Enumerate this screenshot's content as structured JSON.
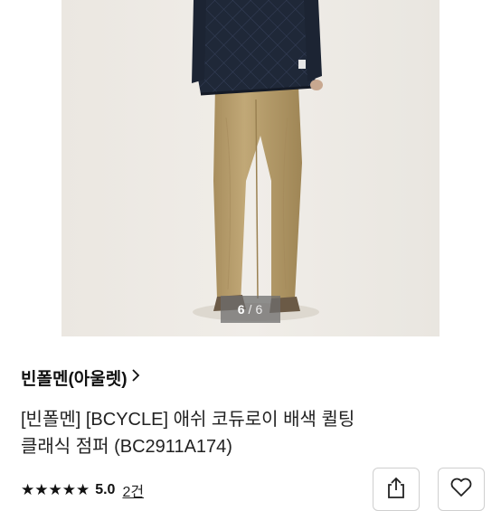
{
  "gallery": {
    "current": "6",
    "separator": "/",
    "total": "6"
  },
  "product": {
    "brand": "빈폴멘(아울렛)",
    "title_line1": "[빈폴멘] [BCYCLE] 애쉬 코듀로이 배색 퀼팅",
    "title_line2": "클래식 점퍼 (BC2911A174)",
    "rating_stars": "★★★★★",
    "rating_score": "5.0",
    "review_count": "2건"
  },
  "icons": {
    "brand_link": "chevron-right-icon",
    "share": "share-icon",
    "wishlist": "heart-icon"
  },
  "colors": {
    "photo_bg": "#ece9e3",
    "jacket": "#1f2838",
    "pants": "#b89e6c"
  }
}
